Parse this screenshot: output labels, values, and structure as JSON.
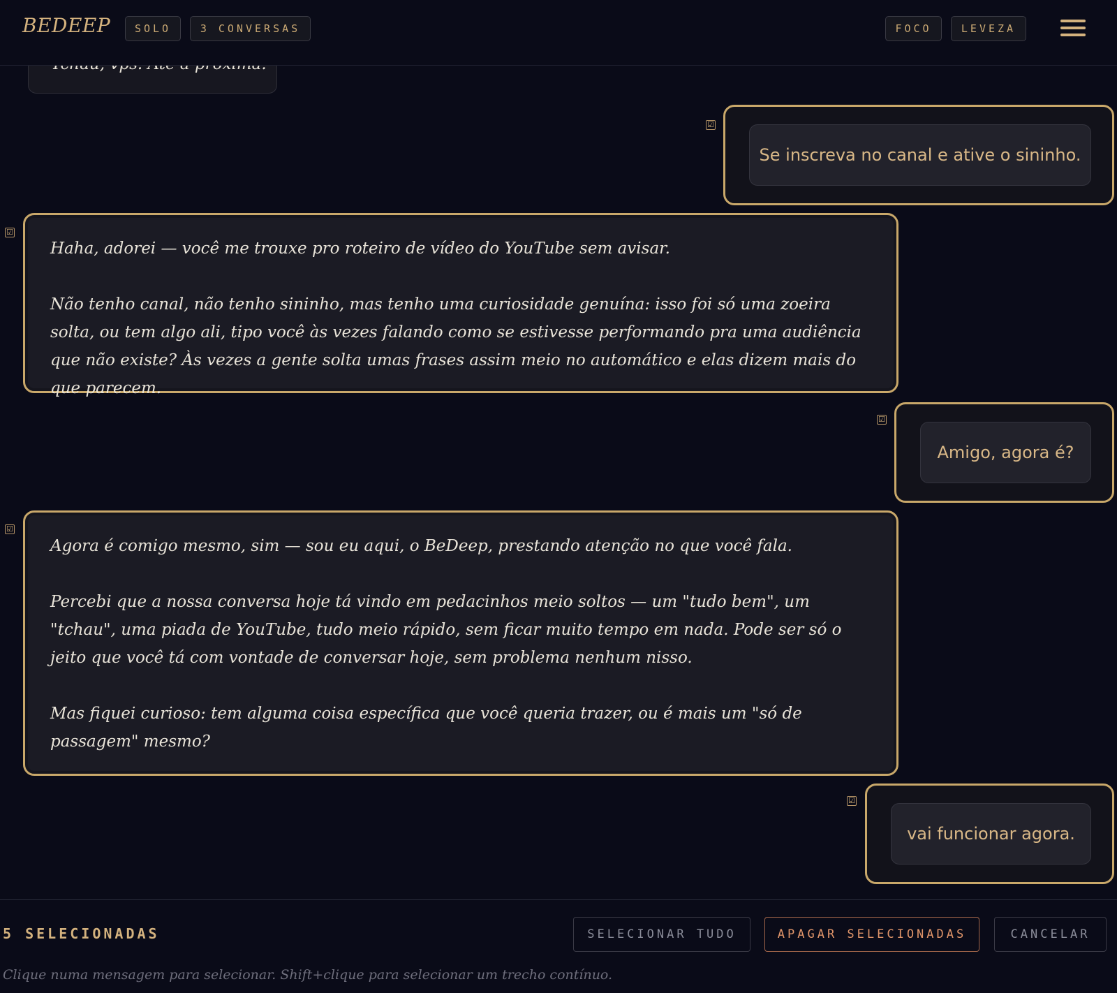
{
  "header": {
    "logo": "BEDEEP",
    "chips_left": [
      "SOLO",
      "3 CONVERSAS"
    ],
    "chips_right": [
      "FOCO",
      "LEVEZA"
    ],
    "menu_icon": "hamburger-menu-icon",
    "accent_color": "#c9a86a"
  },
  "chat": {
    "previous_partial": "Tchau, vps. Até a próxima.",
    "messages": [
      {
        "role": "user",
        "selected": true,
        "paragraphs": [
          "Se inscreva no canal e ative o sininho."
        ]
      },
      {
        "role": "assistant",
        "selected": true,
        "paragraphs": [
          "Haha, adorei — você me trouxe pro roteiro de vídeo do YouTube sem avisar.",
          "Não tenho canal, não tenho sininho, mas tenho uma curiosidade genuína: isso foi só uma zoeira solta, ou tem algo ali, tipo você às vezes falando como se estivesse performando pra uma audiência que não existe? Às vezes a gente solta umas frases assim meio no automático e elas dizem mais do que parecem."
        ]
      },
      {
        "role": "user",
        "selected": true,
        "paragraphs": [
          "Amigo, agora é?"
        ]
      },
      {
        "role": "assistant",
        "selected": true,
        "paragraphs": [
          "Agora é comigo mesmo, sim — sou eu aqui, o BeDeep, prestando atenção no que você fala.",
          "Percebi que a nossa conversa hoje tá vindo em pedacinhos meio soltos — um \"tudo bem\", um \"tchau\", uma piada de YouTube, tudo meio rápido, sem ficar muito tempo em nada. Pode ser só o jeito que você tá com vontade de conversar hoje, sem problema nenhum nisso.",
          "Mas fiquei curioso: tem alguma coisa específica que você queria trazer, ou é mais um \"só de passagem\" mesmo?"
        ]
      },
      {
        "role": "user",
        "selected": true,
        "paragraphs": [
          "vai funcionar agora."
        ]
      }
    ],
    "check_glyph": "☑"
  },
  "selection_bar": {
    "count_label": "5 SELECIONADAS",
    "select_all": "SELECIONAR TUDO",
    "delete_selected": "APAGAR SELECIONADAS",
    "cancel": "CANCELAR",
    "hint": "Clique numa mensagem para selecionar. Shift+clique para selecionar um trecho contínuo."
  }
}
